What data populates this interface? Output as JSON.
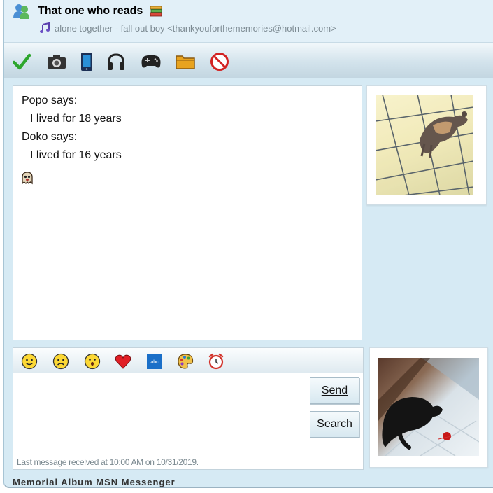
{
  "header": {
    "contact_name": "That one who reads",
    "status_message": "alone together - fall out boy <thankyouforthememories@hotmail.com>"
  },
  "toolbar": {
    "buttons": [
      {
        "name": "check-icon",
        "label": "Accept"
      },
      {
        "name": "camera-icon",
        "label": "Camera"
      },
      {
        "name": "phone-icon",
        "label": "Phone"
      },
      {
        "name": "headphones-icon",
        "label": "Audio"
      },
      {
        "name": "gamepad-icon",
        "label": "Games"
      },
      {
        "name": "folder-icon",
        "label": "Files"
      },
      {
        "name": "block-icon",
        "label": "Block"
      }
    ]
  },
  "conversation": {
    "messages": [
      {
        "sender_line": "Popo says:",
        "text": "I lived for 18 years"
      },
      {
        "sender_line": "Doko says:",
        "text": "I lived for 16 years"
      }
    ],
    "typed_emoticon": "ghost-icon"
  },
  "compose": {
    "emoticons": [
      "smile-icon",
      "sad-icon",
      "surprised-icon",
      "heart-icon",
      "font-icon",
      "palette-icon",
      "alarm-clock-icon"
    ],
    "font_icon_text": "abc",
    "send_label": "Send",
    "search_label": "Search",
    "last_message": "Last message received at 10:00 AM on 10/31/2019."
  },
  "footer": {
    "label": "Memorial Album MSN Messenger"
  },
  "colors": {
    "window_bg": "#d6eaf4",
    "status_text": "#7d8b93",
    "accent_green": "#2da62d",
    "block_red": "#d22222"
  }
}
